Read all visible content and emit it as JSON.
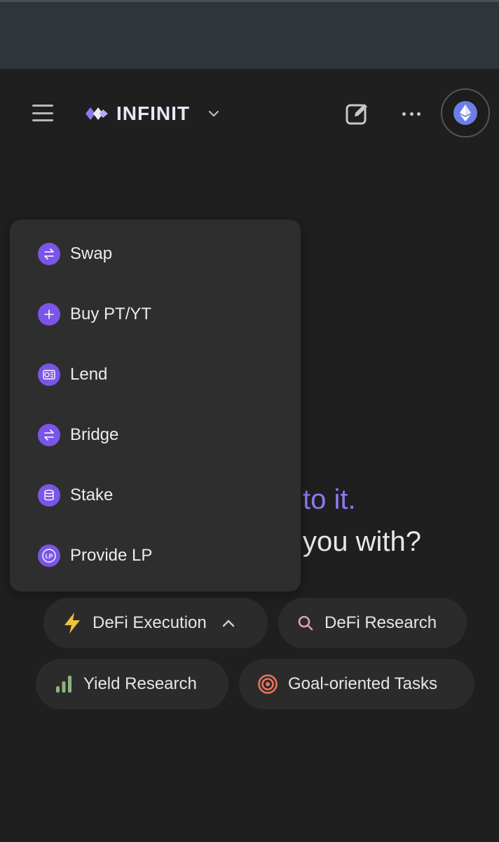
{
  "header": {
    "brand": "INFINIT"
  },
  "headline": {
    "line1": "to it.",
    "line2": "you with?"
  },
  "dropdown": {
    "items": [
      {
        "label": "Swap",
        "icon": "swap-icon"
      },
      {
        "label": "Buy PT/YT",
        "icon": "plus-icon"
      },
      {
        "label": "Lend",
        "icon": "lend-icon"
      },
      {
        "label": "Bridge",
        "icon": "bridge-icon"
      },
      {
        "label": "Stake",
        "icon": "stake-icon"
      },
      {
        "label": "Provide LP",
        "icon": "lp-icon"
      }
    ]
  },
  "chips": {
    "defi_execution": "DeFi Execution",
    "defi_research": "DeFi Research",
    "yield_research": "Yield Research",
    "goal_tasks": "Goal-oriented Tasks"
  },
  "colors": {
    "accent": "#8f79f2",
    "icon_purple": "#7a55e8",
    "lightning": "#f0c23a",
    "search_pink": "#e49cc4",
    "bars_green": "#8fb27e",
    "target_red": "#e8745a",
    "eth_blue": "#6b7fe6"
  }
}
